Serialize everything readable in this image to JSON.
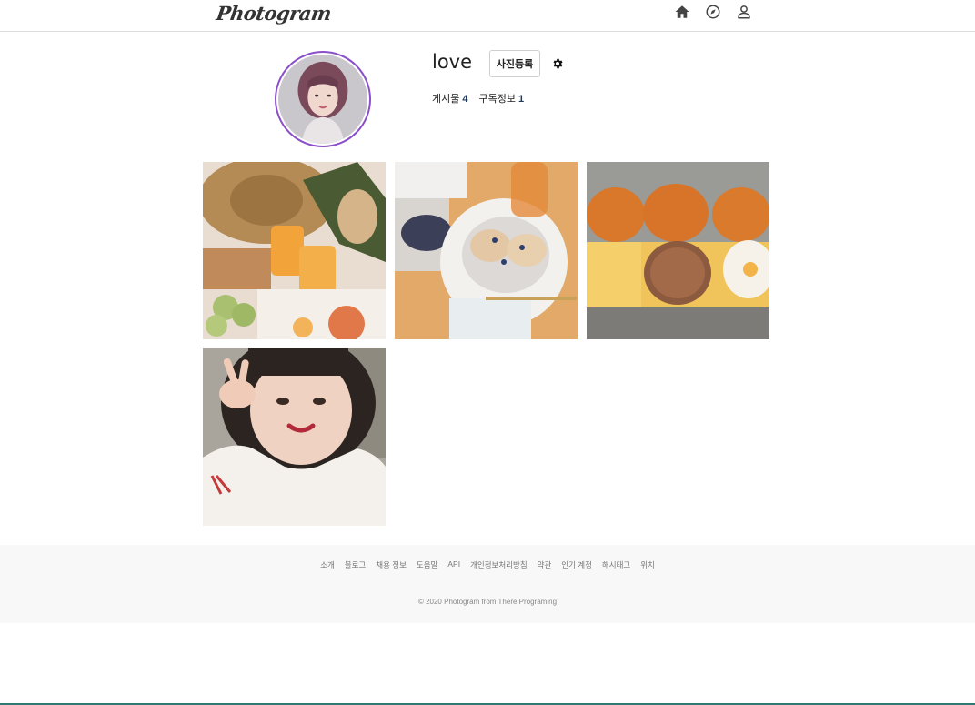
{
  "header": {
    "logo": "Photogram",
    "nav": [
      {
        "icon": "home-icon",
        "label": "home"
      },
      {
        "icon": "compass-icon",
        "label": "explore"
      },
      {
        "icon": "user-icon",
        "label": "profile"
      }
    ]
  },
  "profile": {
    "username": "love",
    "upload_label": "사진등록",
    "posts_label": "게시물",
    "posts_count": "4",
    "subscribe_label": "구독정보",
    "subscribe_count": "1",
    "ring_color": "#8a4fc9"
  },
  "grid": {
    "images": [
      {
        "name": "drinks-picnic-photo"
      },
      {
        "name": "pancakes-photo"
      },
      {
        "name": "burger-buns-photo"
      },
      {
        "name": "selfie-photo"
      }
    ]
  },
  "footer": {
    "links": [
      "소개",
      "블로그",
      "채용 정보",
      "도움말",
      "API",
      "개인정보처리방침",
      "약관",
      "인기 계정",
      "해시태그",
      "위치"
    ],
    "copyright": "© 2020 Photogram from There Programing"
  }
}
